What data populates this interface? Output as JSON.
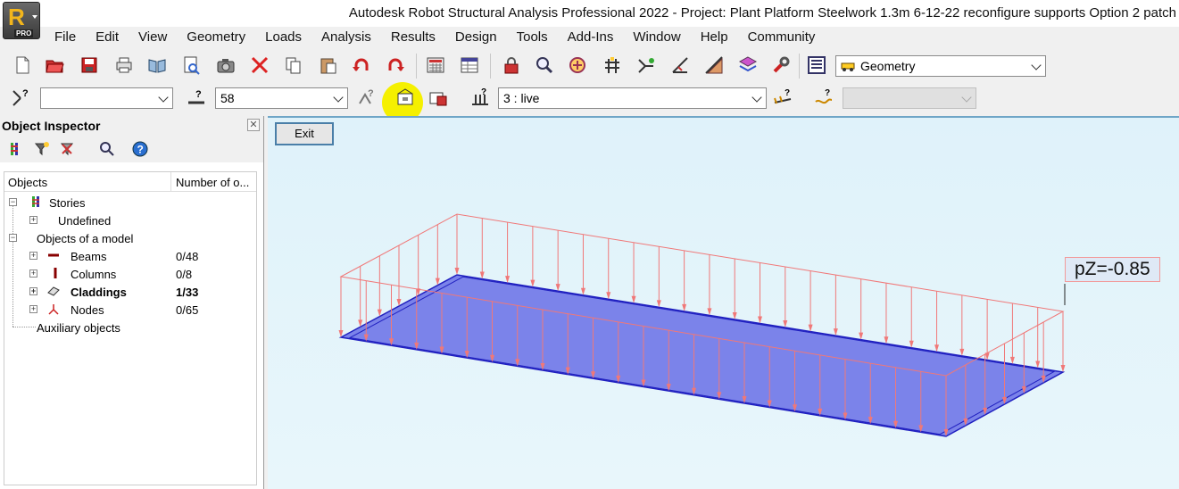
{
  "window": {
    "title": "Autodesk Robot Structural Analysis Professional 2022 - Project: Plant Platform Steelwork 1.3m 6-12-22 reconfigure supports Option 2 patch",
    "logo_letter": "R",
    "logo_badge": "PRO"
  },
  "menu": [
    "File",
    "Edit",
    "View",
    "Geometry",
    "Loads",
    "Analysis",
    "Results",
    "Design",
    "Tools",
    "Add-Ins",
    "Window",
    "Help",
    "Community"
  ],
  "toolbar1": {
    "icons": [
      "new-file-icon",
      "open-folder-icon",
      "save-icon",
      "print-icon",
      "print-preview-icon",
      "report-icon",
      "screen-capture-icon",
      "delete-icon",
      "copy-icon",
      "paste-icon",
      "undo-icon",
      "redo-icon",
      "calculator-icon",
      "table-icon",
      "lock-icon",
      "zoom-icon",
      "zoom-window-icon",
      "structure-view-icon",
      "axis-icon",
      "measure-icon",
      "section-icon",
      "layers-icon",
      "wrench-icon",
      "layout-icon"
    ],
    "layout_selector": {
      "value": "Geometry"
    }
  },
  "toolbar2": {
    "selection_combo": {
      "value": ""
    },
    "bar_selection_combo": {
      "value": "58"
    },
    "load_case_combo": {
      "value": "3 : live"
    },
    "disabled_combo": {
      "value": ""
    },
    "highlight_color": "#f5f000"
  },
  "inspector": {
    "title": "Object Inspector",
    "close_glyph": "✕",
    "columns": {
      "objects": "Objects",
      "number": "Number of o..."
    },
    "tree": [
      {
        "label": "Stories",
        "count": "",
        "expander": "−",
        "bold": false
      },
      {
        "label": "Undefined",
        "count": "",
        "expander": "+",
        "bold": false
      },
      {
        "label": "Objects of a model",
        "count": "",
        "expander": "−",
        "bold": false
      },
      {
        "label": "Beams",
        "count": "0/48",
        "expander": "+",
        "bold": false
      },
      {
        "label": "Columns",
        "count": "0/8",
        "expander": "+",
        "bold": false
      },
      {
        "label": "Claddings",
        "count": "1/33",
        "expander": "+",
        "bold": true
      },
      {
        "label": "Nodes",
        "count": "0/65",
        "expander": "+",
        "bold": false
      },
      {
        "label": "Auxiliary objects",
        "count": "",
        "expander": "",
        "bold": false
      }
    ]
  },
  "viewport": {
    "exit_label": "Exit",
    "load_label": "pZ=-0.85",
    "panel_fill": "#7b83ea",
    "panel_edge": "#2020c0",
    "load_color": "#f07878"
  }
}
